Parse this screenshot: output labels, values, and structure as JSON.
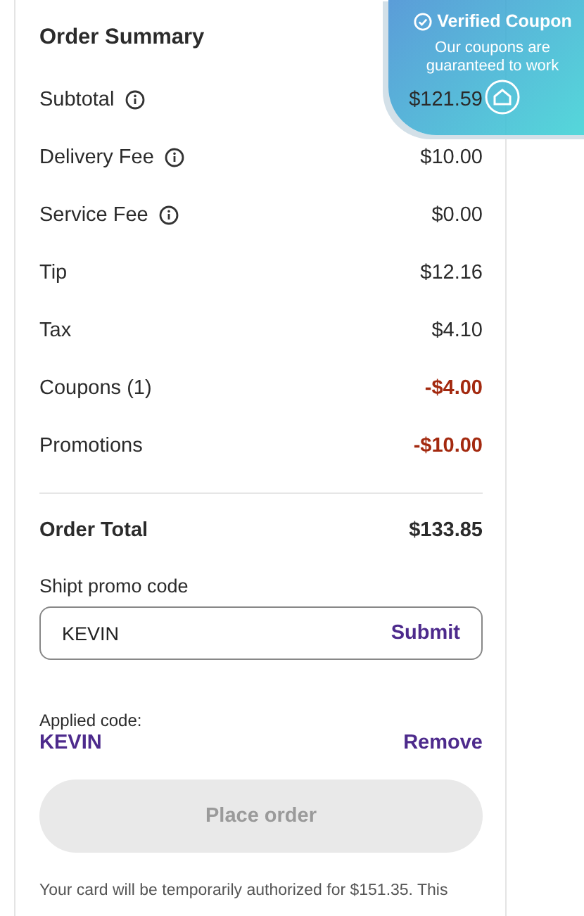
{
  "summary": {
    "title": "Order Summary",
    "rows": [
      {
        "label": "Subtotal",
        "info": true,
        "value": "$121.59",
        "kind": "charge"
      },
      {
        "label": "Delivery Fee",
        "info": true,
        "value": "$10.00",
        "kind": "charge"
      },
      {
        "label": "Service Fee",
        "info": true,
        "value": "$0.00",
        "kind": "charge"
      },
      {
        "label": "Tip",
        "info": false,
        "value": "$12.16",
        "kind": "charge"
      },
      {
        "label": "Tax",
        "info": false,
        "value": "$4.10",
        "kind": "charge"
      },
      {
        "label": "Coupons (1)",
        "info": false,
        "value": "-$4.00",
        "kind": "discount"
      },
      {
        "label": "Promotions",
        "info": false,
        "value": "-$10.00",
        "kind": "discount"
      }
    ],
    "total": {
      "label": "Order Total",
      "value": "$133.85"
    }
  },
  "promo": {
    "label": "Shipt promo code",
    "value": "KEVIN",
    "submit": "Submit"
  },
  "applied": {
    "label": "Applied code:",
    "code": "KEVIN",
    "remove": "Remove"
  },
  "place_order": {
    "label": "Place order",
    "disabled": true
  },
  "note": "Your card will be temporarily authorized for $151.35. This",
  "badge": {
    "title": "Verified Coupon",
    "text": "Our coupons are guaranteed to work"
  }
}
